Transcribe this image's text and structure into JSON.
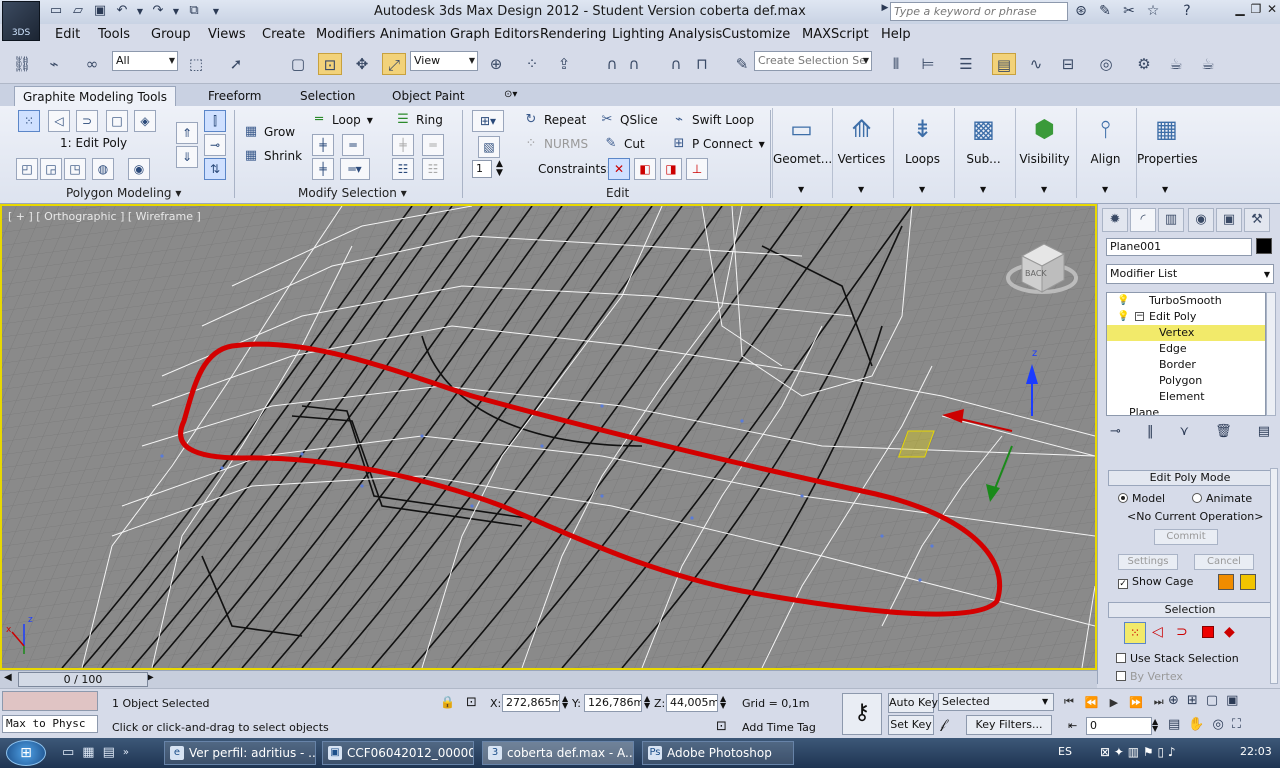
{
  "app": {
    "logo_text": "3DS",
    "title": "Autodesk 3ds Max Design 2012  - Student Version   coberta def.max",
    "search_placeholder": "Type a keyword or phrase"
  },
  "menu": [
    "Edit",
    "Tools",
    "Group",
    "Views",
    "Create",
    "Modifiers",
    "Animation",
    "Graph Editors",
    "Rendering",
    "Lighting Analysis",
    "Customize",
    "MAXScript",
    "Help"
  ],
  "toolbar": {
    "filter_value": "All",
    "ref_coord_value": "View",
    "selection_set_placeholder": "Create Selection Se"
  },
  "ribbon": {
    "tabs": [
      "Graphite Modeling Tools",
      "Freeform",
      "Selection",
      "Object Paint"
    ],
    "polygon_modeling": {
      "current": "1: Edit Poly",
      "label": "Polygon Modeling"
    },
    "modify_selection": {
      "grow": "Grow",
      "shrink": "Shrink",
      "loop": "Loop",
      "ring": "Ring",
      "label": "Modify Selection"
    },
    "edit": {
      "repeat": "Repeat",
      "qslice": "QSlice",
      "swift_loop": "Swift Loop",
      "nurms": "NURMS",
      "cut": "Cut",
      "p_connect": "P Connect",
      "constraints": "Constraints:",
      "spinner_value": "1",
      "label": "Edit"
    },
    "big_buttons": [
      "Geomet...",
      "Vertices",
      "Loops",
      "Sub...",
      "Visibility",
      "Align",
      "Properties"
    ]
  },
  "viewport": {
    "label": "[ + ] [ Orthographic ] [ Wireframe ]",
    "cube_label": "BACK",
    "axis_z": "z",
    "axis_x": "x"
  },
  "command_panel": {
    "object_name": "Plane001",
    "modifier_list": "Modifier List",
    "stack": [
      "TurboSmooth",
      "Edit Poly",
      "Vertex",
      "Edge",
      "Border",
      "Polygon",
      "Element",
      "Plane"
    ],
    "edit_poly_mode": {
      "title": "Edit Poly Mode",
      "model": "Model",
      "animate": "Animate",
      "current_op": "<No Current Operation>",
      "commit": "Commit",
      "settings": "Settings",
      "cancel": "Cancel",
      "show_cage": "Show Cage",
      "cage_color_1": "#f08c00",
      "cage_color_2": "#f2c400"
    },
    "selection": {
      "title": "Selection",
      "use_stack": "Use Stack Selection",
      "by_vertex": "By Vertex"
    }
  },
  "status": {
    "time_slider": "0 / 100",
    "selected": "1 Object Selected",
    "prompt": "Click or click-and-drag to select objects",
    "maxscript": "Max to Physc",
    "x_label": "X:",
    "x_value": "272,865m",
    "y_label": "Y:",
    "y_value": "126,786m",
    "z_label": "Z:",
    "z_value": "44,005m",
    "grid": "Grid = 0,1m",
    "add_time_tag": "Add Time Tag",
    "auto_key": "Auto Key",
    "set_key": "Set Key",
    "key_mode": "Selected",
    "key_filters": "Key Filters...",
    "frame": "0"
  },
  "taskbar": {
    "items": [
      "Ver perfil: adritius - ...",
      "CCF06042012_00000...",
      "coberta def.max - A...",
      "Adobe Photoshop"
    ],
    "lang": "ES",
    "time": "22:03"
  },
  "colors": {
    "viewport_border": "#e8d800",
    "annotation": "#d40000",
    "selected_stack_item": "#f2ea6a"
  }
}
